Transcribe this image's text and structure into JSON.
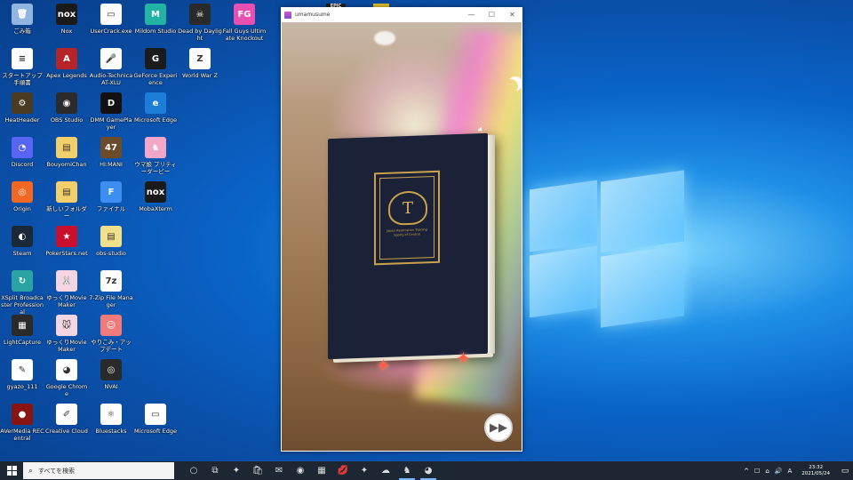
{
  "desktop": {
    "icons": [
      {
        "label": "ごみ箱",
        "color": "#8fb5e0",
        "glyph": "🗑"
      },
      {
        "label": "Nox",
        "color": "#1a1a1a",
        "glyph": "nox"
      },
      {
        "label": "UserCrack.exe",
        "color": "#ffffff",
        "glyph": "▭"
      },
      {
        "label": "Mildom Studio",
        "color": "#21b3a3",
        "glyph": "M"
      },
      {
        "label": "Dead by Daylight",
        "color": "#2a2a2a",
        "glyph": "☠"
      },
      {
        "label": "Fall Guys Ultimate Knockout",
        "color": "#e84fb1",
        "glyph": "FG"
      },
      {
        "label": "スタートアップ手順書",
        "color": "#ffffff",
        "glyph": "≡"
      },
      {
        "label": "Apex Legends",
        "color": "#b52426",
        "glyph": "A"
      },
      {
        "label": "Audio-Technica AT-XLU",
        "color": "#ffffff",
        "glyph": "🎤"
      },
      {
        "label": "GeForce Experience",
        "color": "#1b1b1b",
        "glyph": "G"
      },
      {
        "label": "World War Z",
        "color": "#ffffff",
        "glyph": "Z"
      },
      {
        "label": "HeatHeader",
        "color": "#4a3a22",
        "glyph": "⚙"
      },
      {
        "label": "OBS Studio",
        "color": "#2b2b2b",
        "glyph": "◉"
      },
      {
        "label": "DMM GamePlayer",
        "color": "#111111",
        "glyph": "D"
      },
      {
        "label": "Microsoft Edge",
        "color": "#1c7ed6",
        "glyph": "e"
      },
      {
        "label": "Discord",
        "color": "#5865f2",
        "glyph": "◔"
      },
      {
        "label": "BouyomiChan",
        "color": "#f3cf6b",
        "glyph": "▤"
      },
      {
        "label": "HI:MANI",
        "color": "#6b4b2a",
        "glyph": "47"
      },
      {
        "label": "ウマ娘 プリティーダービー",
        "color": "#f2a7c9",
        "glyph": "♞"
      },
      {
        "label": "Origin",
        "color": "#f26722",
        "glyph": "◎"
      },
      {
        "label": "新しいフォルダー",
        "color": "#f3cf6b",
        "glyph": "▤"
      },
      {
        "label": "ファイナル",
        "color": "#3c8ef0",
        "glyph": "F"
      },
      {
        "label": "MobaXterm",
        "color": "#1a1a1a",
        "glyph": "nox"
      },
      {
        "label": "Steam",
        "color": "#1b2838",
        "glyph": "◐"
      },
      {
        "label": "PokerStars.net",
        "color": "#c8102e",
        "glyph": "★"
      },
      {
        "label": "obs-studio",
        "color": "#f3e08a",
        "glyph": "▤"
      },
      {
        "label": "XSplit Broadcaster Professional",
        "color": "#2aa3a3",
        "glyph": "↻"
      },
      {
        "label": "ゆっくりMovieMaker",
        "color": "#f6d5e3",
        "glyph": "🐰"
      },
      {
        "label": "7-Zip File Manager",
        "color": "#ffffff",
        "glyph": "7z"
      },
      {
        "label": "LightCapture",
        "color": "#2a2a2a",
        "glyph": "▦"
      },
      {
        "label": "ゆっくりMovieMaker",
        "color": "#f6d5e3",
        "glyph": "🐭"
      },
      {
        "label": "やりこみ・アップデート",
        "color": "#f17a7a",
        "glyph": "☺"
      },
      {
        "label": "gyazo_111",
        "color": "#ffffff",
        "glyph": "✎"
      },
      {
        "label": "Google Chrome",
        "color": "#ffffff",
        "glyph": "◕"
      },
      {
        "label": "NVAI",
        "color": "#2a2a2a",
        "glyph": "◎"
      },
      {
        "label": "AVerMedia RECentral",
        "color": "#8a1414",
        "glyph": "●"
      },
      {
        "label": "Creative Cloud",
        "color": "#ffffff",
        "glyph": "✐"
      },
      {
        "label": "Bluestacks",
        "color": "#ffffff",
        "glyph": "⚛"
      },
      {
        "label": "Microsoft Edge",
        "color": "#ffffff",
        "glyph": "▭"
      }
    ]
  },
  "behind": {
    "epic_label": "EPIC"
  },
  "window": {
    "title": "umamusume",
    "minimize": "—",
    "maximize": "☐",
    "close": "✕"
  },
  "game": {
    "emblem": "T",
    "emblem_text": "Japan Association Training Sports of Central",
    "skip_icon": "▶▶"
  },
  "taskbar": {
    "search_placeholder": "すべてを検索",
    "apps": [
      "○",
      "⧉",
      "✦",
      "🛍",
      "✉",
      "◉",
      "▦",
      "💋",
      "✦",
      "☁",
      "♞",
      "◕"
    ],
    "tray_items": [
      "^",
      "☐",
      "⌂",
      "🔊",
      "A"
    ],
    "time": "23:32",
    "date": "2021/05/24",
    "notification_icon": "▭"
  },
  "colors": {
    "taskbar_bg": "#1d2733",
    "accent": "#7ab9ff"
  }
}
